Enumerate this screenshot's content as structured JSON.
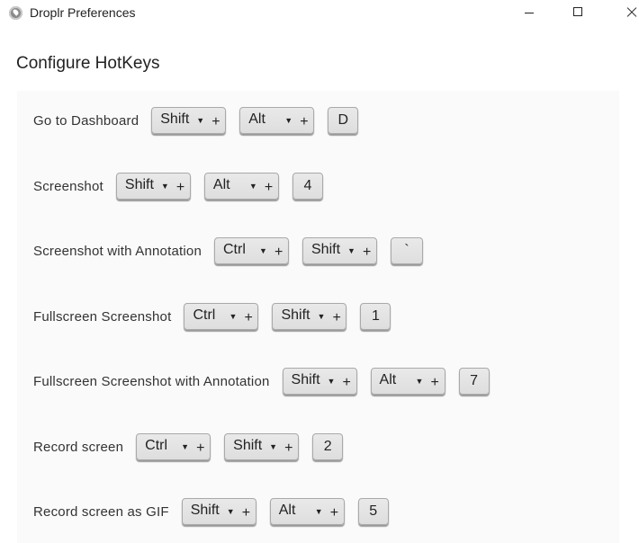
{
  "window": {
    "title": "Droplr Preferences",
    "icon": "droplr-logo-icon"
  },
  "page": {
    "heading": "Configure HotKeys"
  },
  "hotkeys": [
    {
      "label": "Go to Dashboard",
      "mod1": "Shift",
      "mod2": "Alt",
      "key": "D"
    },
    {
      "label": "Screenshot",
      "mod1": "Shift",
      "mod2": "Alt",
      "key": "4"
    },
    {
      "label": "Screenshot with Annotation",
      "mod1": "Ctrl",
      "mod2": "Shift",
      "key": "`"
    },
    {
      "label": "Fullscreen Screenshot",
      "mod1": "Ctrl",
      "mod2": "Shift",
      "key": "1"
    },
    {
      "label": "Fullscreen Screenshot with Annotation",
      "mod1": "Shift",
      "mod2": "Alt",
      "key": "7"
    },
    {
      "label": "Record screen",
      "mod1": "Ctrl",
      "mod2": "Shift",
      "key": "2"
    },
    {
      "label": "Record screen as GIF",
      "mod1": "Shift",
      "mod2": "Alt",
      "key": "5"
    }
  ],
  "symbols": {
    "plus": "+",
    "dropdown_arrow": "▼"
  },
  "colors": {
    "panel_bg": "#fafafa",
    "key_bg": "#e3e3e3",
    "key_border": "#a9a9a9"
  }
}
